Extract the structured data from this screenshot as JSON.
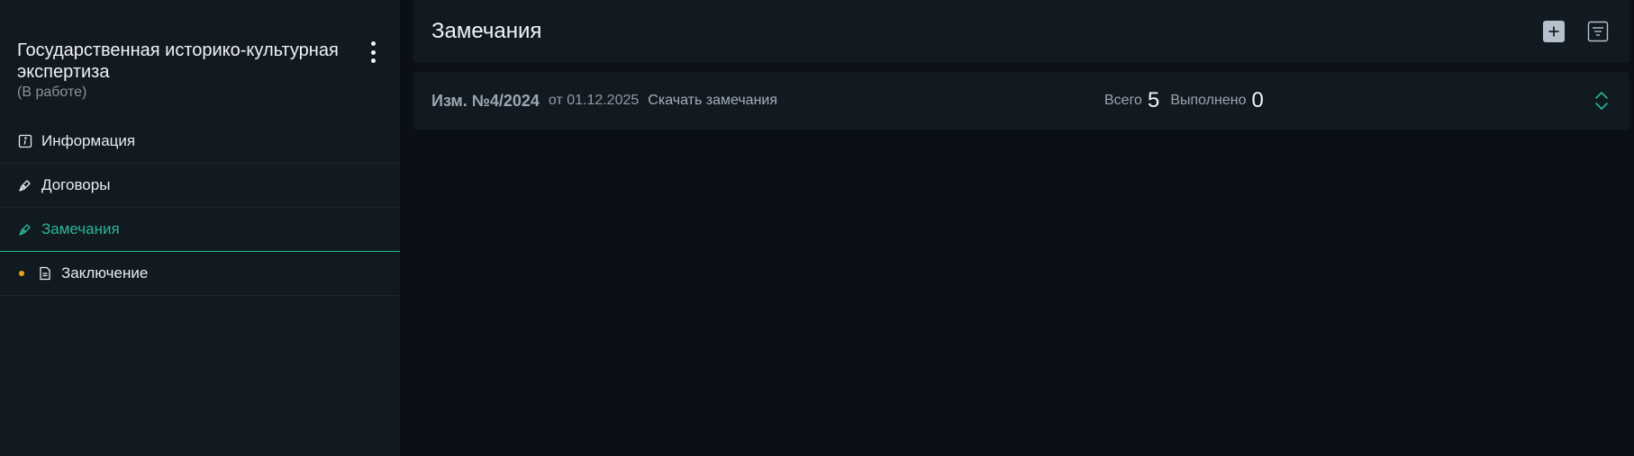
{
  "sidebar": {
    "project_title": "Государственная историко-культурная экспертиза",
    "project_status": "(В работе)",
    "menu_icon": "kebab-menu-icon",
    "items": [
      {
        "label": "Информация",
        "icon": "info-icon",
        "active": false
      },
      {
        "label": "Договоры",
        "icon": "pen-icon",
        "active": false
      },
      {
        "label": "Замечания",
        "icon": "pen-icon",
        "active": true
      },
      {
        "label": "Заключение",
        "icon": "document-icon",
        "active": false,
        "badge_color": "#e8a317"
      }
    ]
  },
  "main": {
    "title": "Замечания",
    "actions": {
      "add_icon": "plus-icon",
      "filter_icon": "filter-icon"
    },
    "revision": {
      "number": "Изм. №4/2024",
      "date": "от 01.12.2025",
      "download_label": "Скачать замечания",
      "total_label": "Всего",
      "total_value": "5",
      "done_label": "Выполнено",
      "done_value": "0",
      "expand_icon": "chevron-updown-icon"
    }
  },
  "colors": {
    "background": "#0b1016",
    "panel": "#121a21",
    "accent": "#2bb596",
    "warning_dot": "#e8a317"
  }
}
